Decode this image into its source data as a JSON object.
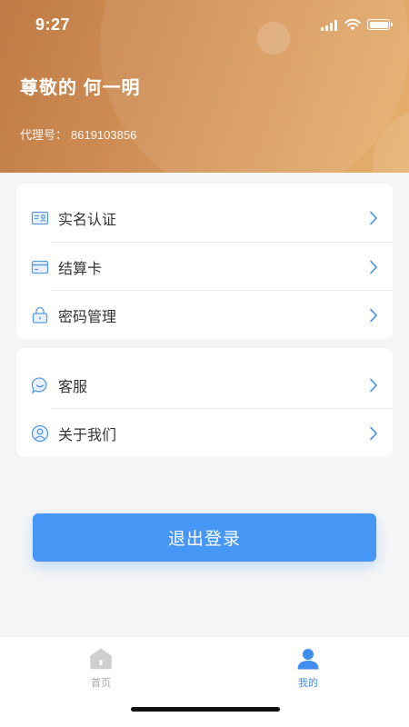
{
  "status_bar": {
    "time": "9:27"
  },
  "profile": {
    "greeting": "尊敬的 何一明",
    "agent_label": "代理号：",
    "agent_number": "8619103856"
  },
  "menu_group_1": [
    {
      "label": "实名认证",
      "icon": "id-card-icon"
    },
    {
      "label": "结算卡",
      "icon": "bank-card-icon"
    },
    {
      "label": "密码管理",
      "icon": "lock-icon"
    }
  ],
  "menu_group_2": [
    {
      "label": "客服",
      "icon": "chat-bubble-icon"
    },
    {
      "label": "关于我们",
      "icon": "person-circle-icon"
    }
  ],
  "logout_label": "退出登录",
  "tabbar": {
    "home_label": "首页",
    "mine_label": "我的",
    "active_tab": "我的"
  },
  "colors": {
    "accent": "#4596f5",
    "header_start": "#c07a45",
    "header_end": "#e6b06e",
    "icon_blue": "#5b9be3"
  },
  "battery_level": 1.0
}
